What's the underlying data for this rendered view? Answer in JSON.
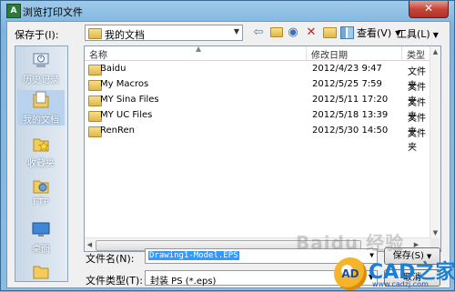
{
  "window": {
    "title": "浏览打印文件",
    "app_icon": "dialog-app-icon",
    "close_label": "✕"
  },
  "toolbar": {
    "look_in_label": "保存于(I):",
    "look_in_value": "我的文档",
    "views_label": "查看(V)",
    "tools_label": "工具(L)",
    "icons": [
      "back-icon",
      "up-folder-icon",
      "search-web-icon",
      "delete-icon",
      "new-folder-icon",
      "views-icon"
    ]
  },
  "places": [
    {
      "label": "历史记录",
      "icon": "history-icon"
    },
    {
      "label": "我的文档",
      "icon": "my-documents-icon",
      "selected": true
    },
    {
      "label": "收藏夹",
      "icon": "favorites-icon"
    },
    {
      "label": "FTP",
      "icon": "ftp-icon"
    },
    {
      "label": "桌面",
      "icon": "desktop-icon"
    }
  ],
  "file_list": {
    "columns": [
      "名称",
      "修改日期",
      "类型"
    ],
    "rows": [
      {
        "name": "Baidu",
        "modified": "2012/4/23 9:47",
        "type": "文件夹"
      },
      {
        "name": "My Macros",
        "modified": "2012/5/25 7:59",
        "type": "文件夹"
      },
      {
        "name": "MY Sina Files",
        "modified": "2012/5/11 17:20",
        "type": "文件夹"
      },
      {
        "name": "MY UC Files",
        "modified": "2012/5/18 13:39",
        "type": "文件夹"
      },
      {
        "name": "RenRen",
        "modified": "2012/5/30 14:50",
        "type": "文件夹"
      }
    ]
  },
  "file_name": {
    "label": "文件名(N):",
    "value": "Drawing1-Model.EPS"
  },
  "file_type": {
    "label": "文件类型(T):",
    "value": "封装 PS (*.eps)"
  },
  "buttons": {
    "open": "保存(S)",
    "cancel": "取消"
  },
  "watermarks": {
    "baidu": "Baidu 经验",
    "cad_logo_text": "AD",
    "cad_text": "CAD之家",
    "cad_url": "www.cadzj.com"
  },
  "colors": {
    "title_gradient": "#9ec9ea",
    "selection": "#3399ff",
    "close_button": "#c4463a"
  }
}
